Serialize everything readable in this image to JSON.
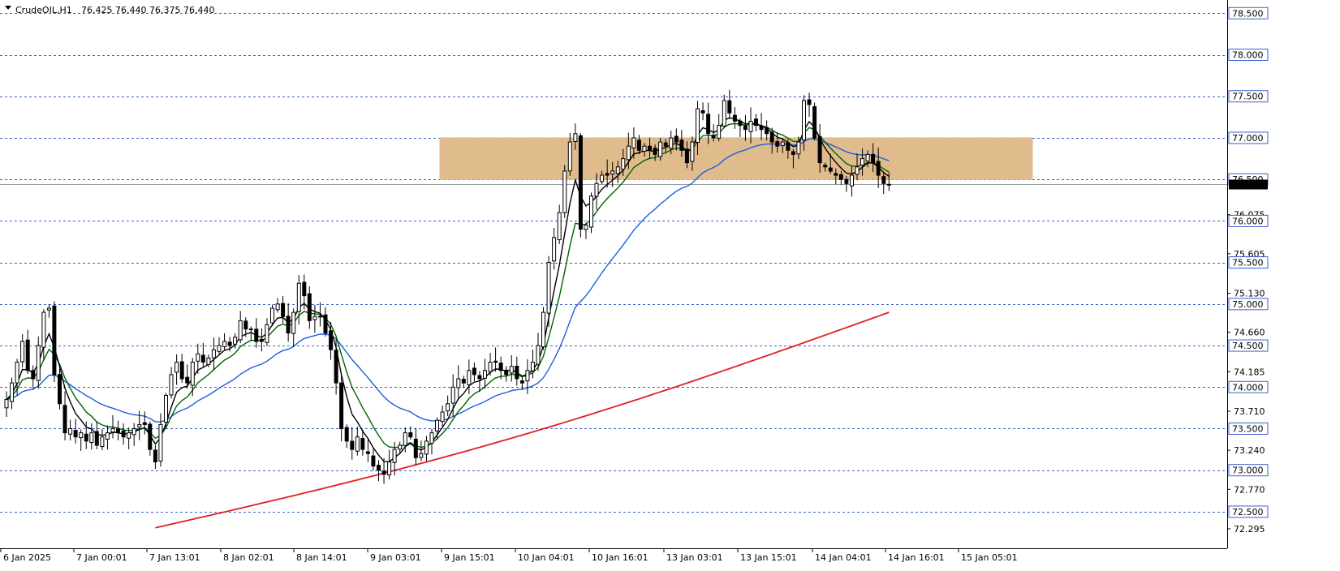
{
  "chart_data": {
    "type": "candlestick",
    "symbol": "CrudeOIL,H1",
    "ohlc_header": "76.425 76.440 76.375 76.440",
    "ylim": [
      72.06,
      78.62
    ],
    "y_ticks": [
      "76.075",
      "75.605",
      "75.130",
      "74.660",
      "74.185",
      "73.710",
      "73.240",
      "72.770",
      "72.295"
    ],
    "level_lines": [
      78.5,
      78.0,
      77.5,
      77.0,
      76.5,
      76.0,
      75.5,
      75.0,
      74.5,
      74.0,
      73.5,
      73.0,
      72.5
    ],
    "level_labels": [
      "78.500",
      "78.000",
      "77.500",
      "77.000",
      "76.500",
      "76.000",
      "75.500",
      "75.000",
      "74.500",
      "74.000",
      "73.500",
      "73.000",
      "72.500"
    ],
    "current_price": 76.44,
    "x_labels": [
      "6 Jan 2025",
      "7 Jan 00:01",
      "7 Jan 13:01",
      "8 Jan 02:01",
      "8 Jan 14:01",
      "9 Jan 03:01",
      "9 Jan 15:01",
      "10 Jan 04:01",
      "10 Jan 16:01",
      "13 Jan 03:01",
      "13 Jan 15:01",
      "14 Jan 04:01",
      "14 Jan 16:01",
      "15 Jan 05:01"
    ],
    "zone": {
      "low": 76.5,
      "high": 77.0,
      "start_index": 80,
      "end_index": 140,
      "color": "#deb887"
    },
    "closes": [
      73.85,
      74.05,
      74.3,
      74.55,
      74.2,
      74.1,
      74.5,
      74.9,
      74.95,
      74.15,
      73.8,
      73.45,
      73.5,
      73.4,
      73.45,
      73.35,
      73.45,
      73.3,
      73.4,
      73.45,
      73.5,
      73.45,
      73.4,
      73.45,
      73.5,
      73.55,
      73.55,
      73.25,
      73.1,
      73.55,
      73.9,
      74.15,
      74.3,
      74.1,
      74.05,
      74.3,
      74.4,
      74.3,
      74.35,
      74.45,
      74.5,
      74.55,
      74.5,
      74.6,
      74.8,
      74.7,
      74.7,
      74.55,
      74.55,
      74.75,
      74.95,
      75.0,
      74.85,
      74.65,
      74.9,
      75.25,
      75.1,
      74.8,
      74.85,
      74.85,
      74.65,
      74.45,
      74.05,
      73.5,
      73.35,
      73.25,
      73.4,
      73.25,
      73.2,
      73.05,
      73.0,
      72.95,
      73.1,
      73.25,
      73.3,
      73.45,
      73.4,
      73.15,
      73.2,
      73.35,
      73.45,
      73.6,
      73.7,
      73.8,
      74.0,
      74.1,
      74.05,
      74.2,
      74.15,
      74.1,
      74.2,
      74.3,
      74.3,
      74.2,
      74.15,
      74.25,
      74.1,
      74.05,
      74.2,
      74.3,
      74.5,
      74.9,
      75.5,
      75.8,
      76.1,
      76.6,
      76.95,
      77.05,
      75.9,
      75.95,
      76.3,
      76.45,
      76.55,
      76.55,
      76.6,
      76.65,
      76.75,
      76.9,
      77.0,
      76.85,
      76.9,
      76.85,
      76.8,
      76.95,
      76.9,
      77.0,
      76.95,
      76.85,
      76.7,
      76.95,
      77.35,
      77.3,
      77.05,
      77.0,
      77.15,
      77.45,
      77.3,
      77.2,
      77.15,
      77.1,
      77.2,
      77.15,
      77.1,
      77.05,
      76.95,
      76.9,
      76.95,
      76.85,
      76.8,
      76.95,
      77.45,
      77.4,
      77.0,
      76.7,
      76.65,
      76.6,
      76.55,
      76.5,
      76.45,
      76.55,
      76.65,
      76.75,
      76.8,
      76.7,
      76.55,
      76.45,
      76.44
    ],
    "series": [
      {
        "name": "ma-black",
        "color": "#000000"
      },
      {
        "name": "ma-green",
        "color": "#006400"
      },
      {
        "name": "ma-blue",
        "color": "#1e5fd8"
      },
      {
        "name": "ma-red",
        "color": "#e02020"
      }
    ],
    "colors": {
      "bull_body": "#ffffff",
      "bear_body": "#000000",
      "wick": "#000000",
      "grid": "#3a5fcd",
      "zone_border": "#deb887"
    }
  }
}
